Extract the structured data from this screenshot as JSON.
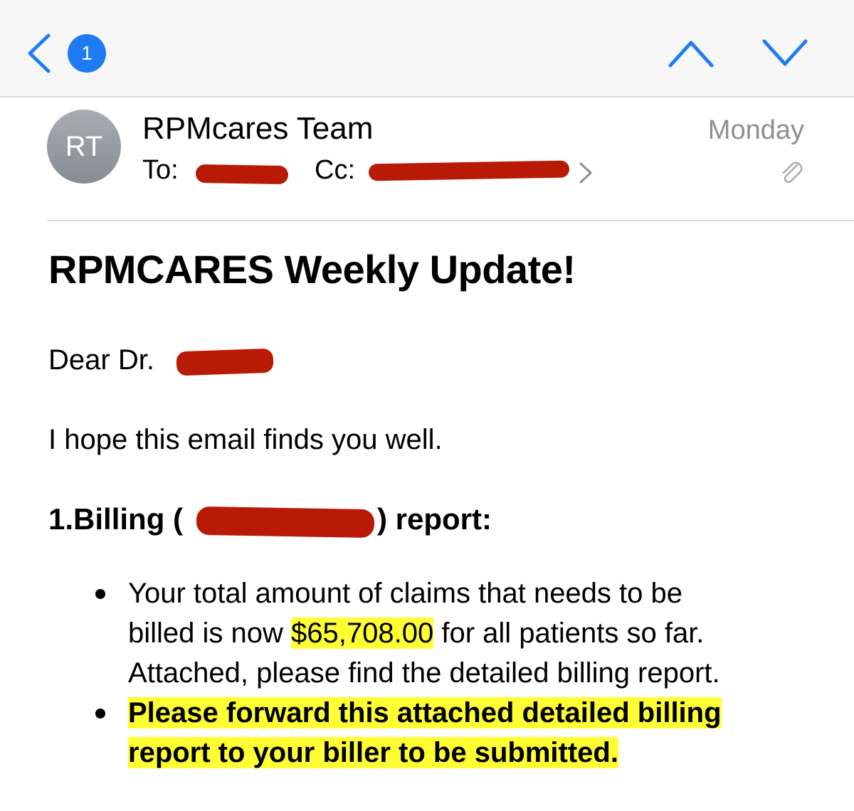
{
  "navbar": {
    "unread_count": "1",
    "colors": {
      "accent": "#1d7cf2"
    }
  },
  "header": {
    "avatar_initials": "RT",
    "sender": "RPMcares Team",
    "date": "Monday",
    "to_label": "To:",
    "cc_label": "Cc:"
  },
  "email": {
    "subject": "RPMCARES Weekly Update!",
    "greeting": "Dear Dr.",
    "intro": "I hope this email finds you well.",
    "section_prefix": "1.Billing (",
    "section_suffix": ") report:",
    "bullet1_line1": "Your total amount of claims that needs to be",
    "bullet1_line2_pre": "billed is now ",
    "bullet1_amount": "$65,708.00",
    "bullet1_line2_post": " for all patients so far.",
    "bullet1_line3": "Attached, please find the detailed billing report.",
    "bullet2_line1": "Please forward this attached detailed billing",
    "bullet2_line2": "report to your biller to be submitted.",
    "colors": {
      "highlight": "#ffff33",
      "redaction": "#b81a06"
    }
  }
}
